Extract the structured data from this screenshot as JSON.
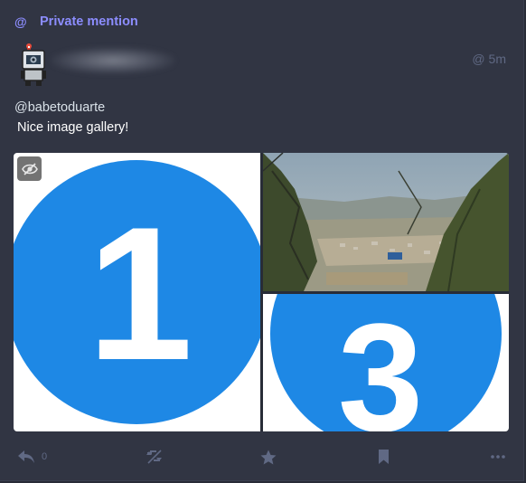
{
  "prepend": {
    "icon": "at-icon",
    "at_symbol": "@",
    "label": "Private mention"
  },
  "header": {
    "avatar_icon": "robot-avatar",
    "timestamp_symbol": "@",
    "timestamp": "5m"
  },
  "content": {
    "mention": "@babetoduarte",
    "text": "Nice image gallery!"
  },
  "gallery": {
    "images": [
      {
        "name": "image-number-one",
        "number": "1"
      },
      {
        "name": "image-landscape-photo"
      },
      {
        "name": "image-number-three",
        "number": "3"
      }
    ],
    "hide_icon": "eye-slash-icon"
  },
  "actions": {
    "reply_count": "0",
    "icons": [
      "reply-icon",
      "boost-disabled-icon",
      "star-icon",
      "bookmark-icon",
      "ellipsis-icon"
    ]
  },
  "colors": {
    "background": "#282c37",
    "card": "#313543",
    "accent": "#8c8dff",
    "muted": "#606984",
    "blue": "#1e88e5"
  }
}
